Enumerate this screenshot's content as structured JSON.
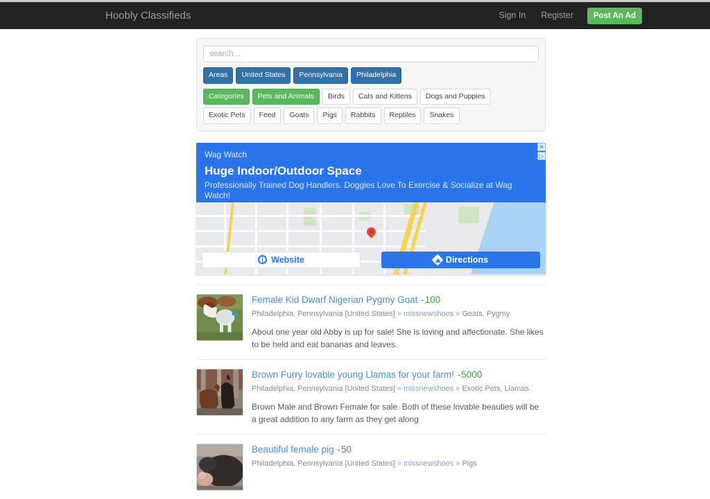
{
  "navbar": {
    "brand": "Hoobly Classifieds",
    "links": [
      {
        "label": "Sign In",
        "name": "sign-in-link"
      },
      {
        "label": "Register",
        "name": "register-link"
      }
    ],
    "post_ad_label": "Post An Ad",
    "brand_bg": "#222222",
    "post_ad_color": "#5cb85c"
  },
  "search": {
    "value": "",
    "placeholder": "search..."
  },
  "filters": {
    "areas": [
      {
        "label": "Areas",
        "style": "blue"
      },
      {
        "label": "United States",
        "style": "blue"
      },
      {
        "label": "Pennsylvania",
        "style": "blue"
      },
      {
        "label": "Philadelphia",
        "style": "blue"
      }
    ],
    "categories": [
      {
        "label": "Categories",
        "style": "green"
      },
      {
        "label": "Pets and Animals",
        "style": "green"
      },
      {
        "label": "Birds",
        "style": "plain"
      },
      {
        "label": "Cats and Kittens",
        "style": "plain"
      },
      {
        "label": "Dogs and Puppies",
        "style": "plain"
      },
      {
        "label": "Exotic Pets",
        "style": "plain"
      },
      {
        "label": "Feed",
        "style": "plain"
      },
      {
        "label": "Goats",
        "style": "plain"
      },
      {
        "label": "Pigs",
        "style": "plain"
      },
      {
        "label": "Rabbits",
        "style": "plain"
      },
      {
        "label": "Reptiles",
        "style": "plain"
      },
      {
        "label": "Snakes",
        "style": "plain"
      }
    ]
  },
  "ad": {
    "advertiser": "Wag Watch",
    "headline": "Huge Indoor/Outdoor Space",
    "description": "Professionally Trained Dog Handlers. Doggies Love To Exercise & Socialize at Wag Watch!",
    "close_glyph": "✕",
    "adchoices_glyph": "▷",
    "website_button": "Website",
    "directions_button": "Directions",
    "accent": "#2a74ec"
  },
  "listings": [
    {
      "title": "Female Kid Dwarf Nigerian Pygmy Goat",
      "dash": "-",
      "price": "100",
      "location": "Philadelphia, Pennsylvania [United States]",
      "sep1": "»",
      "user": "missnewshoes",
      "sep2": "»",
      "category": "Goats, Pygmy",
      "description": "About one year old Abby is up for sale! She is loving and affectionate. She likes to be held and eat bananas and leaves.",
      "thumb_alt": "goat-photo"
    },
    {
      "title": "Brown Furry lovable young Llamas for your farm!",
      "dash": "-",
      "price": "5000",
      "location": "Philadelphia, Pennsylvania [United States]",
      "sep1": "»",
      "user": "missnewshoes",
      "sep2": "»",
      "category": "Exotic Pets, Llamas",
      "description": "Brown Male and Brown Female for sale. Both of these lovable beauties will be a great addition to any farm as they get along",
      "thumb_alt": "llama-photo"
    },
    {
      "title": "Beautiful female pig",
      "dash": "-",
      "price": "50",
      "location": "Philadelphia, Pennsylvania [United States]",
      "sep1": "»",
      "user": "missnewshoes",
      "sep2": "»",
      "category": "Pigs",
      "description": "",
      "thumb_alt": "pig-photo"
    }
  ]
}
